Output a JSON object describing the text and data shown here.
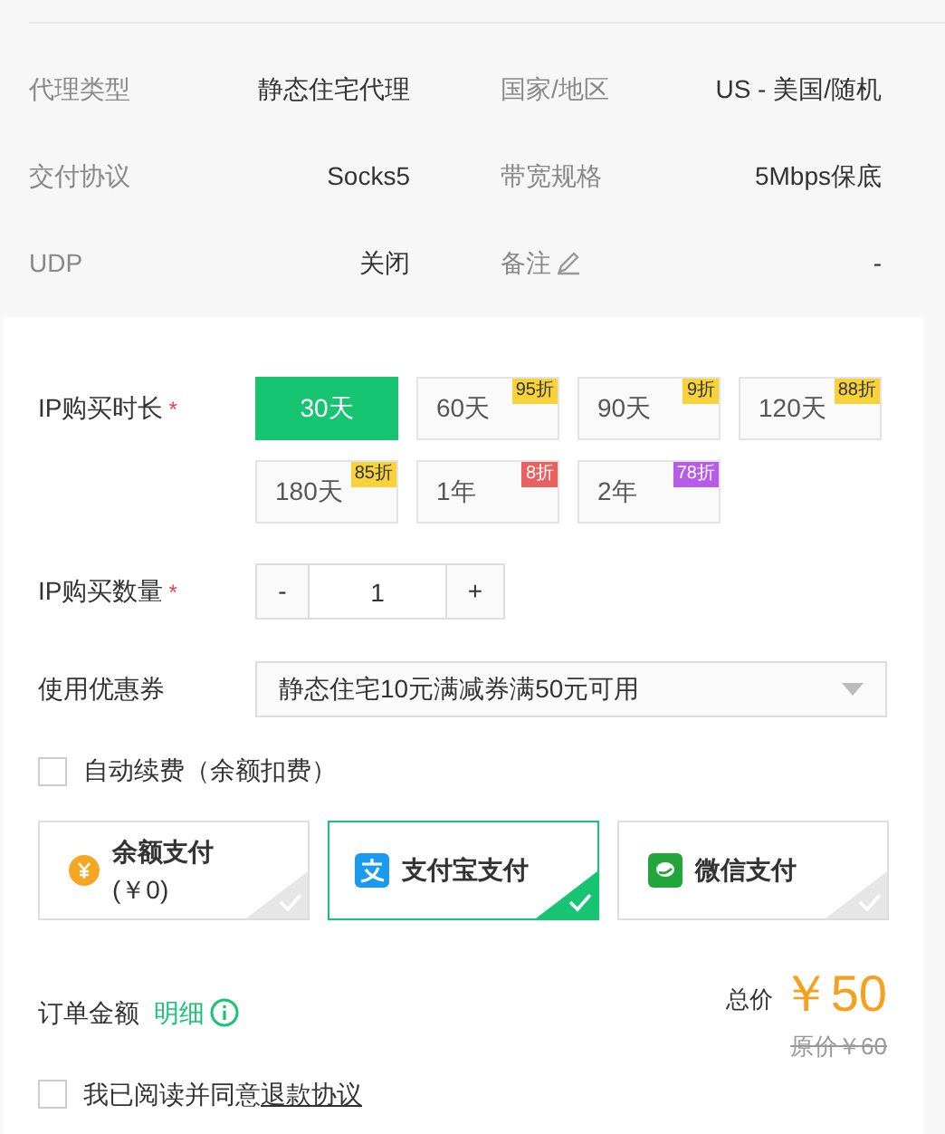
{
  "info": [
    {
      "label": "代理类型",
      "value": "静态住宅代理"
    },
    {
      "label": "国家/地区",
      "value": "US - 美国/随机"
    },
    {
      "label": "交付协议",
      "value": "Socks5"
    },
    {
      "label": "带宽规格",
      "value": "5Mbps保底"
    },
    {
      "label": "UDP",
      "value": "关闭"
    },
    {
      "label": "备注",
      "value": "-",
      "editable": true
    }
  ],
  "duration": {
    "label": "IP购买时长",
    "required": "*",
    "options": [
      {
        "label": "30天",
        "selected": true
      },
      {
        "label": "60天",
        "selected": false,
        "badge": "95折",
        "color": "#f8d23a"
      },
      {
        "label": "90天",
        "selected": false,
        "badge": "9折",
        "color": "#f8d23a"
      },
      {
        "label": "120天",
        "selected": false,
        "badge": "88折",
        "color": "#f8d23a"
      },
      {
        "label": "180天",
        "selected": false,
        "badge": "85折",
        "color": "#f8d23a"
      },
      {
        "label": "1年",
        "selected": false,
        "badge": "8折",
        "color": "#e96060"
      },
      {
        "label": "2年",
        "selected": false,
        "badge": "78折",
        "color": "#b65ce6"
      }
    ]
  },
  "quantity": {
    "label": "IP购买数量",
    "required": "*",
    "minus": "-",
    "value": "1",
    "plus": "+"
  },
  "coupon": {
    "label": "使用优惠券",
    "value": "静态住宅10元满减券满50元可用"
  },
  "auto_renew": {
    "label": "自动续费（余额扣费）",
    "checked": false
  },
  "payment": [
    {
      "kind": "balance",
      "label": "余额支付",
      "sub": "(￥0)",
      "selected": false
    },
    {
      "kind": "alipay",
      "label": "支付宝支付",
      "selected": true
    },
    {
      "kind": "wechat",
      "label": "微信支付",
      "selected": false
    }
  ],
  "order": {
    "label": "订单金额",
    "detail": "明细",
    "total_label": "总价",
    "total": "￥50",
    "original": "原价￥60"
  },
  "agreement": {
    "text": "我已阅读并同意",
    "link": "退款协议",
    "checked": false
  }
}
